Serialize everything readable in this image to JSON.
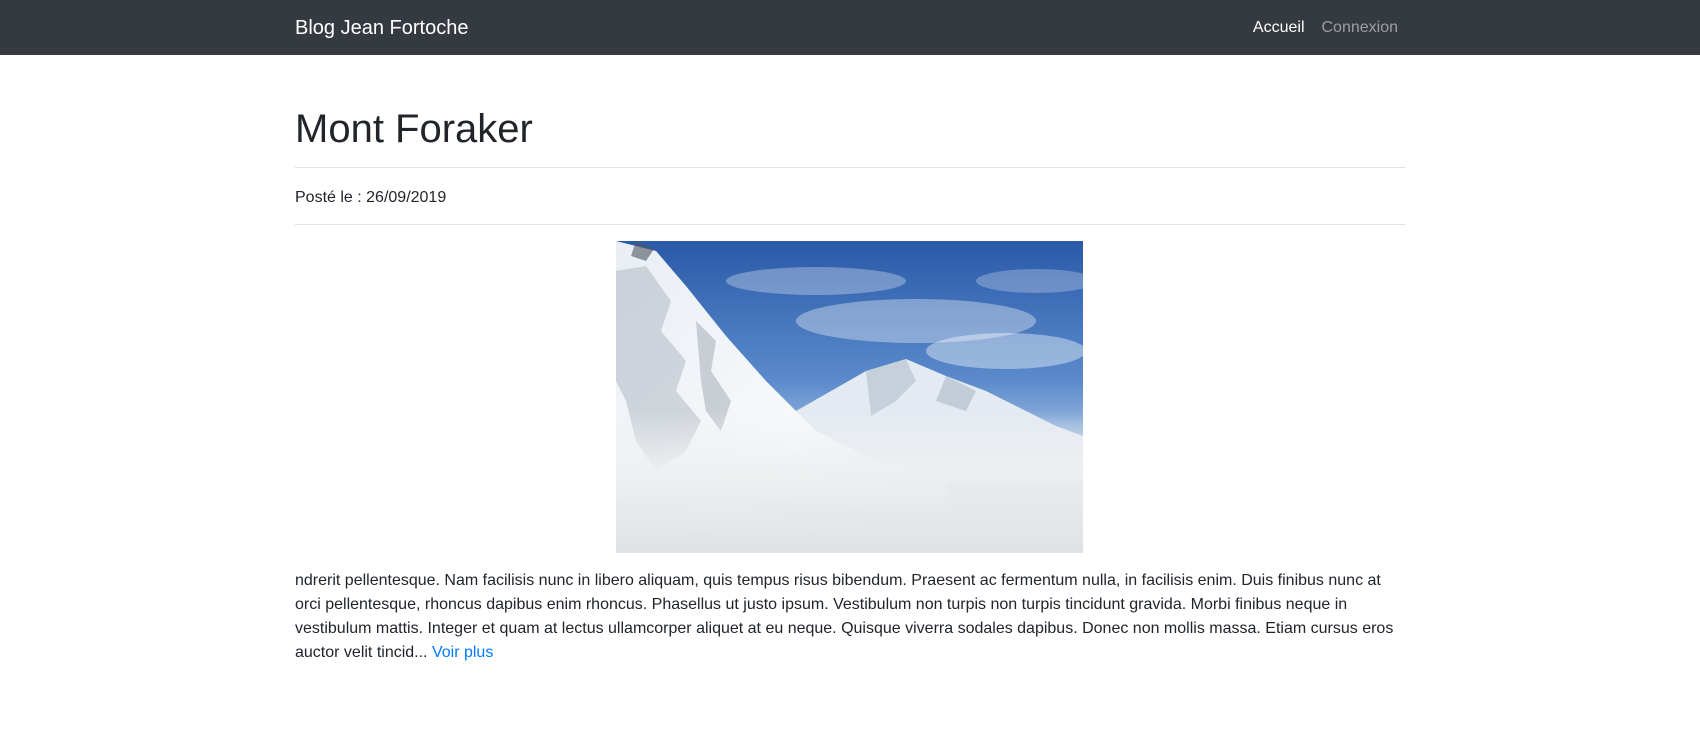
{
  "navbar": {
    "brand": "Blog Jean Fortoche",
    "links": [
      {
        "label": "Accueil",
        "active": true
      },
      {
        "label": "Connexion",
        "active": false
      }
    ]
  },
  "post": {
    "title": "Mont Foraker",
    "date": "Posté le : 26/09/2019",
    "image": {
      "subject": "snowy-mountain-photo"
    },
    "excerpt": "ndrerit pellentesque. Nam facilisis nunc in libero aliquam, quis tempus risus bibendum. Praesent ac fermentum nulla, in facilisis enim. Duis finibus nunc at orci pellentesque, rhoncus dapibus enim rhoncus. Phasellus ut justo ipsum. Vestibulum non turpis non turpis tincidunt gravida. Morbi finibus neque in vestibulum mattis. Integer et quam at lectus ullamcorper aliquet at eu neque. Quisque viverra sodales dapibus. Donec non mollis massa. Etiam cursus eros auctor velit tincid...",
    "read_more": "Voir plus"
  },
  "colors": {
    "navbar_bg": "#343a40",
    "link": "#007bff",
    "text": "#212529",
    "divider": "#dee2e6"
  }
}
